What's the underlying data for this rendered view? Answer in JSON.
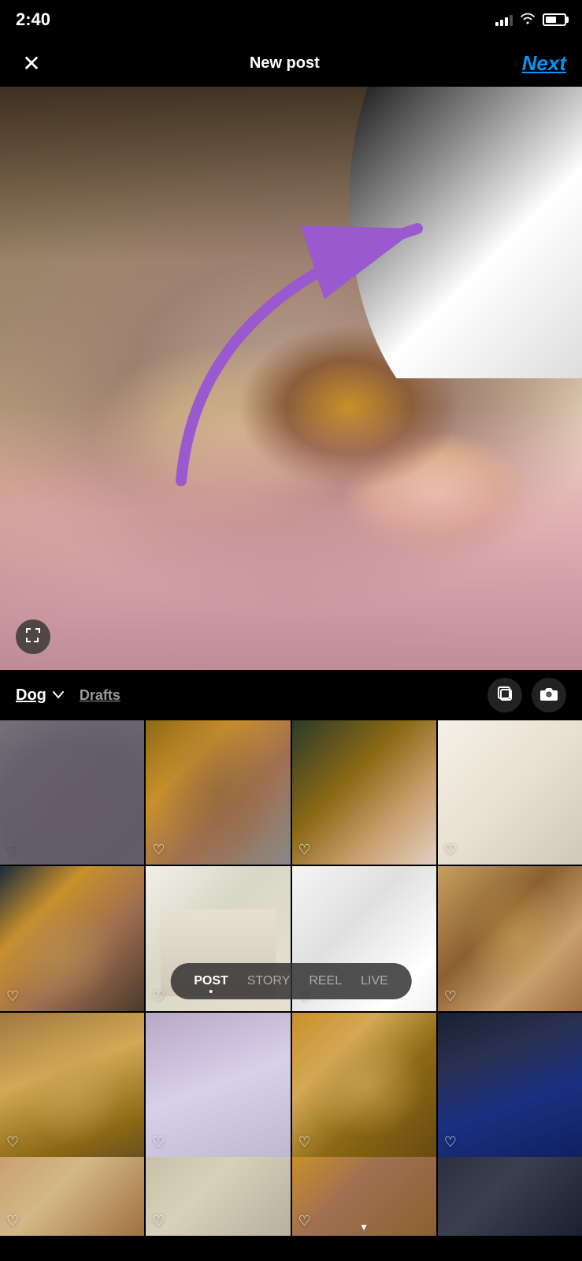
{
  "statusBar": {
    "time": "2:40"
  },
  "header": {
    "closeLabel": "✕",
    "title": "New post",
    "nextLabel": "Next"
  },
  "galleryControls": {
    "albumName": "Dog",
    "draftsLabel": "Drafts"
  },
  "bottomTabs": {
    "items": [
      {
        "label": "POST",
        "active": true
      },
      {
        "label": "STORY",
        "active": false
      },
      {
        "label": "REEL",
        "active": false
      },
      {
        "label": "LIVE",
        "active": false
      }
    ]
  },
  "icons": {
    "expand": "⛶",
    "multiSelect": "⬜",
    "camera": "📷",
    "chevronDown": "∨",
    "heart": "♡"
  }
}
